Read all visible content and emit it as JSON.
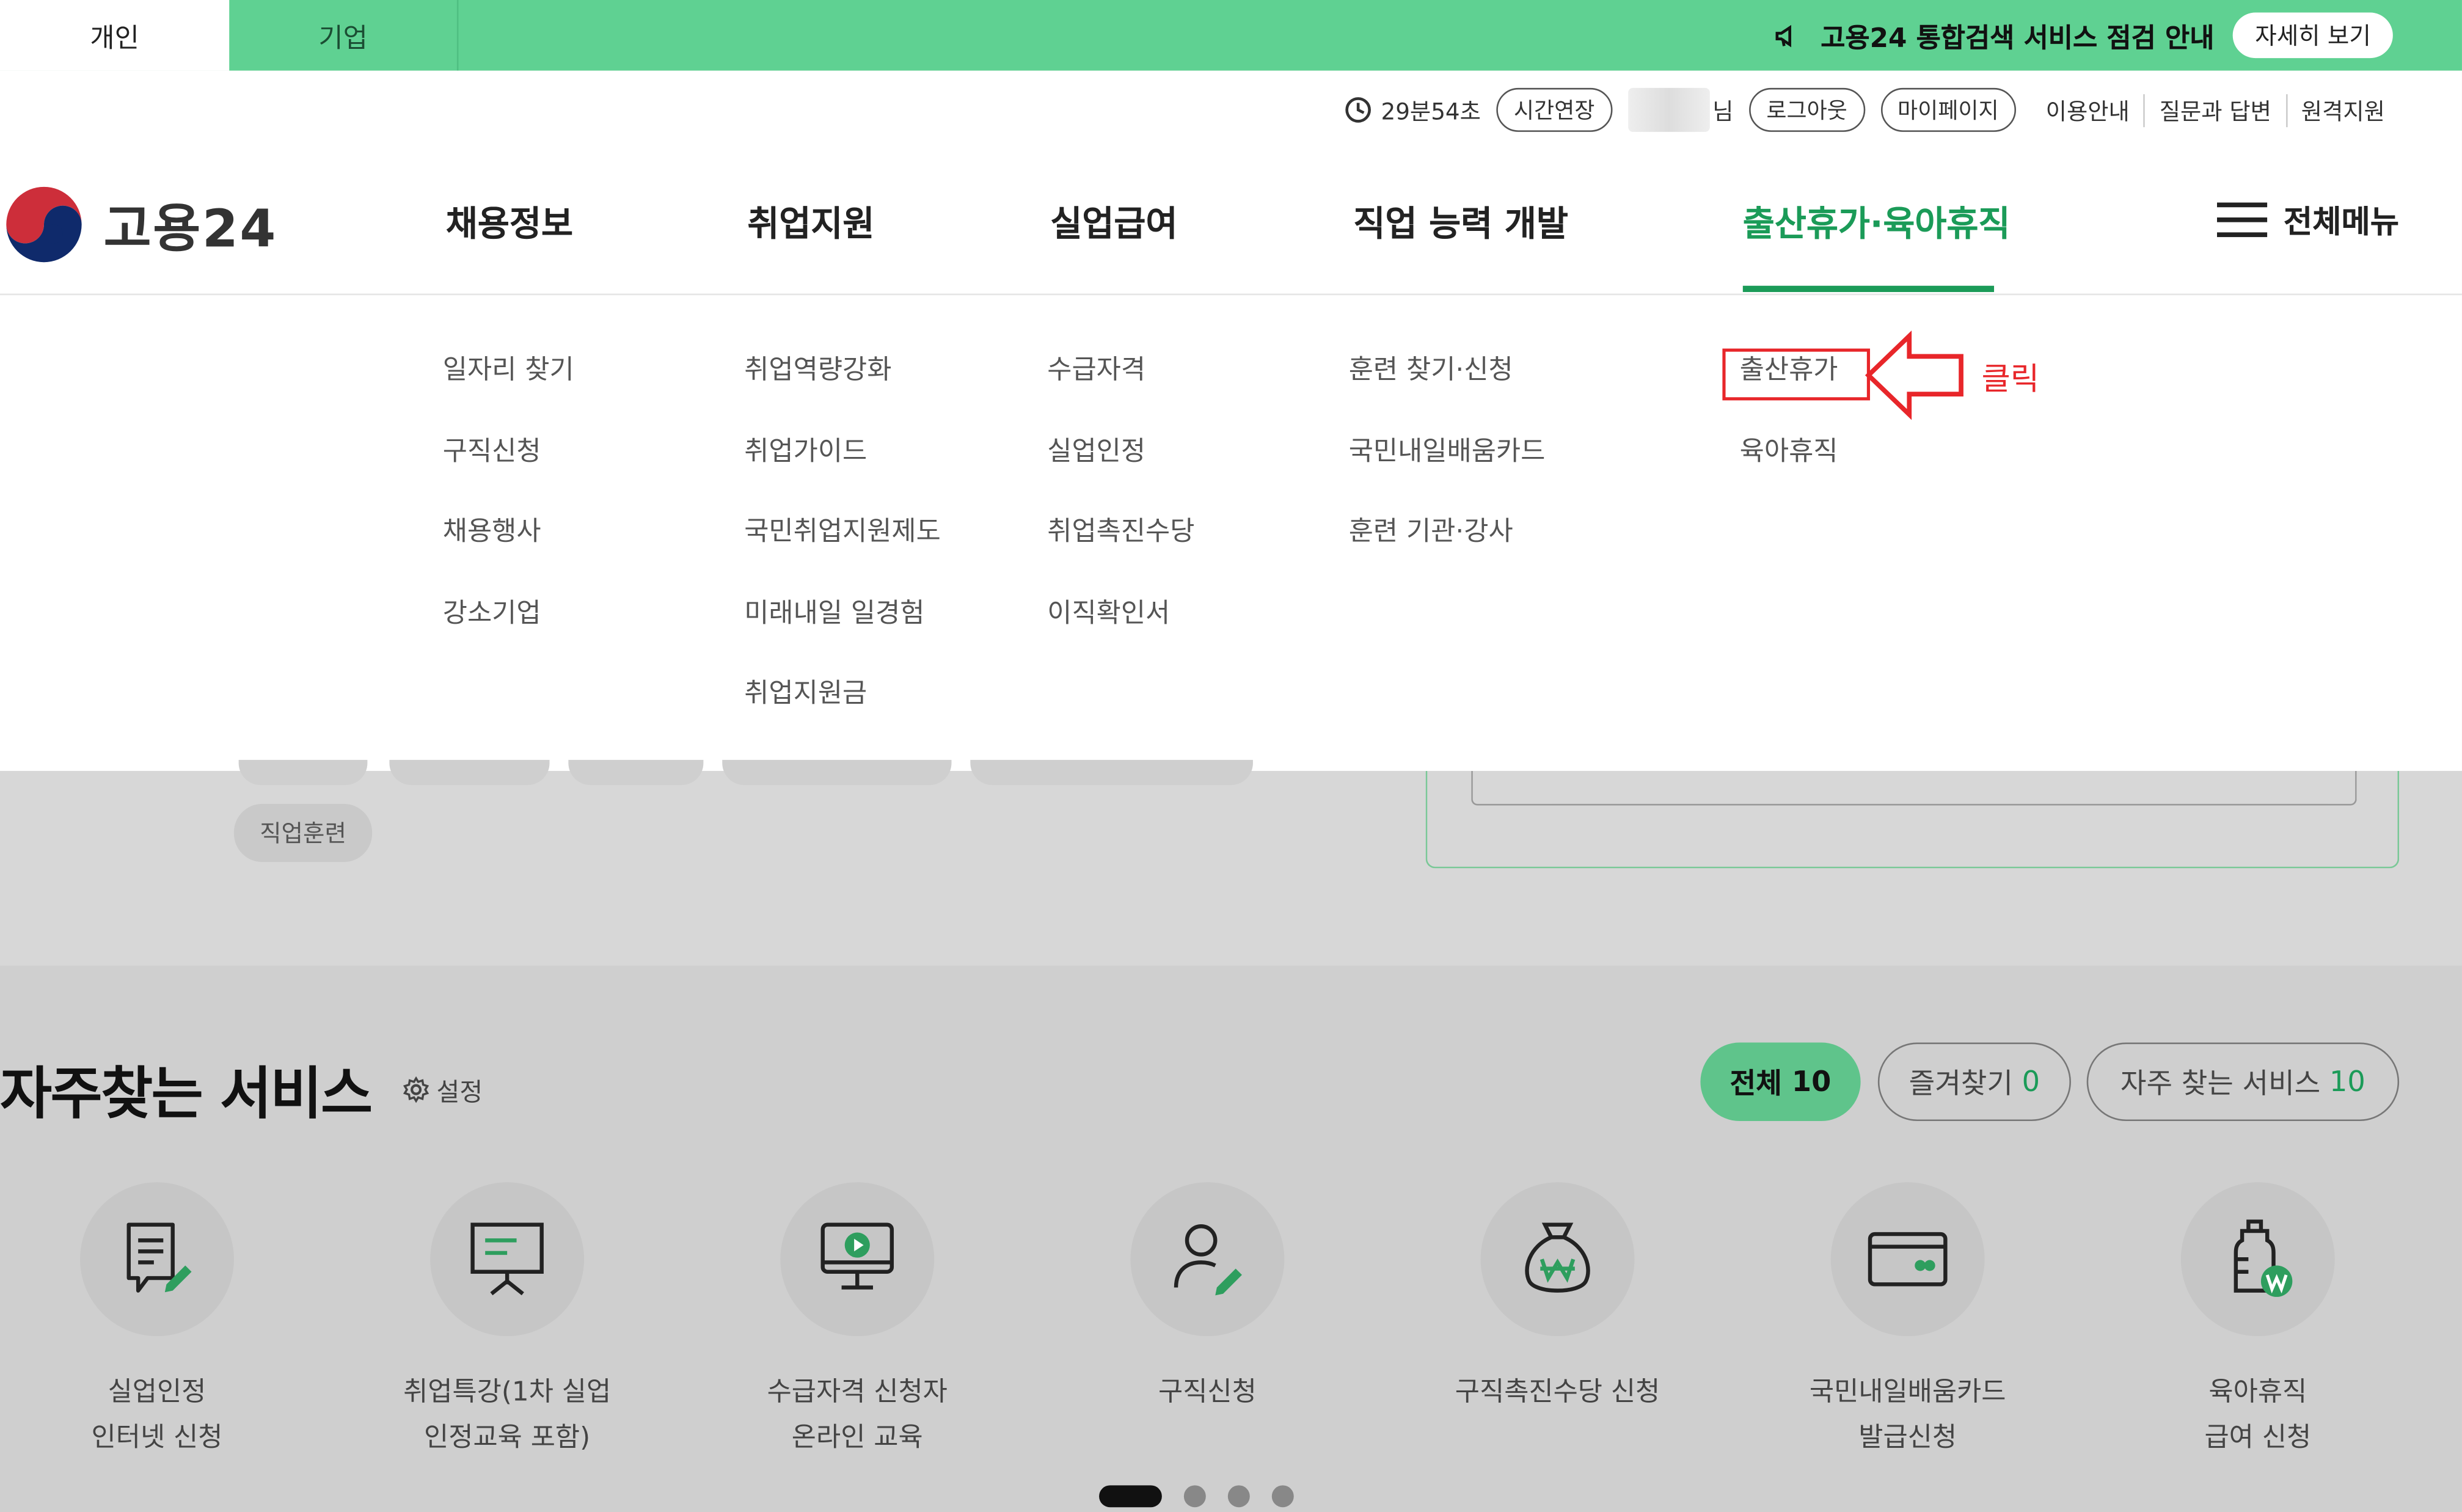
{
  "topbar": {
    "tab_personal": "개인",
    "tab_company": "기업",
    "notice_text": "고용24 통합검색 서비스 점검 안내",
    "notice_button": "자세히 보기",
    "bg_color": "#5fd192"
  },
  "utility": {
    "timer": "29분54초",
    "extend": "시간연장",
    "user_suffix": "님",
    "logout": "로그아웃",
    "mypage": "마이페이지",
    "links": [
      "이용안내",
      "질문과 답변",
      "원격지원"
    ]
  },
  "logo": {
    "text": "고용24"
  },
  "gnb": {
    "items": [
      "채용정보",
      "취업지원",
      "실업급여",
      "직업 능력 개발",
      "출산휴가·육아휴직"
    ],
    "active_index": 4,
    "all_menu": "전체메뉴",
    "accent": "#1b9b58"
  },
  "submenus": [
    [
      "일자리 찾기",
      "구직신청",
      "채용행사",
      "강소기업"
    ],
    [
      "취업역량강화",
      "취업가이드",
      "국민취업지원제도",
      "미래내일 일경험",
      "취업지원금"
    ],
    [
      "수급자격",
      "실업인정",
      "취업촉진수당",
      "이직확인서"
    ],
    [
      "훈련 찾기·신청",
      "국민내일배움카드",
      "훈련 기관·강사"
    ],
    [
      "출산휴가",
      "육아휴직"
    ]
  ],
  "annotation": {
    "label": "클릭",
    "color": "#e8262a"
  },
  "background": {
    "chip": "직업훈련"
  },
  "services": {
    "title": "자주찾는 서비스",
    "setting": "설정",
    "filters": [
      {
        "label": "전체",
        "count": "10"
      },
      {
        "label": "즐겨찾기",
        "count": "0"
      },
      {
        "label": "자주 찾는 서비스",
        "count": "10"
      }
    ],
    "items": [
      {
        "icon": "document-edit-icon",
        "label": "실업인정\n인터넷 신청"
      },
      {
        "icon": "presentation-board-icon",
        "label": "취업특강(1차 실업\n인정교육 포함)"
      },
      {
        "icon": "monitor-play-icon",
        "label": "수급자격 신청자\n온라인 교육"
      },
      {
        "icon": "person-edit-icon",
        "label": "구직신청"
      },
      {
        "icon": "money-bag-icon",
        "label": "구직촉진수당 신청"
      },
      {
        "icon": "card-icon",
        "label": "국민내일배움카드\n발급신청"
      },
      {
        "icon": "baby-bottle-icon",
        "label": "육아휴직\n급여 신청"
      }
    ]
  },
  "carousel": {
    "pages": 4,
    "current": 1
  }
}
